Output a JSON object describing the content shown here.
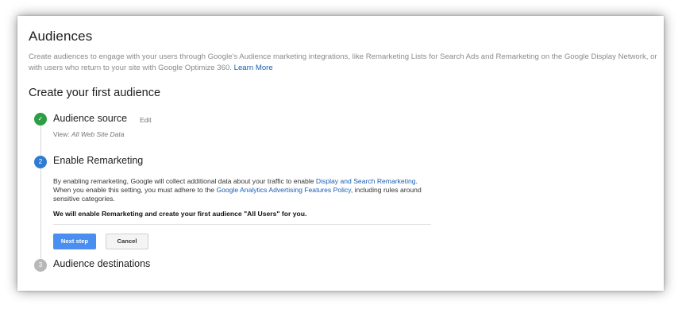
{
  "page": {
    "title": "Audiences",
    "description": "Create audiences to engage with your users through Google's Audience marketing integrations, like Remarketing Lists for Search Ads and Remarketing on the Google Display Network, or with users who return to your site with Google Optimize 360.",
    "learn_more": "Learn More"
  },
  "section": {
    "title": "Create your first audience"
  },
  "steps": [
    {
      "icon": "checkmark-icon",
      "icon_text": "✓",
      "title": "Audience source",
      "edit_label": "Edit",
      "view_label": "View:",
      "view_value": "All Web Site Data"
    },
    {
      "icon": "step-number",
      "icon_text": "2",
      "title": "Enable Remarketing",
      "body_1": "By enabling remarketing, Google will collect additional data about your traffic to enable",
      "link_1": "Display and Search Remarketing",
      "body_2": ". When you enable this setting, you must adhere to the",
      "link_2": "Google Analytics Advertising Features Policy",
      "body_3": ", including rules around sensitive categories.",
      "bold_text": "We will enable Remarketing and create your first audience \"All Users\" for you.",
      "next_label": "Next step",
      "cancel_label": "Cancel"
    },
    {
      "icon": "step-number",
      "icon_text": "3",
      "title": "Audience destinations"
    }
  ],
  "colors": {
    "done": "#2e9e44",
    "active": "#2f7bd1",
    "pending": "#b8b8b8",
    "link": "#1a5fb4",
    "primary_button": "#4a8ff0"
  }
}
